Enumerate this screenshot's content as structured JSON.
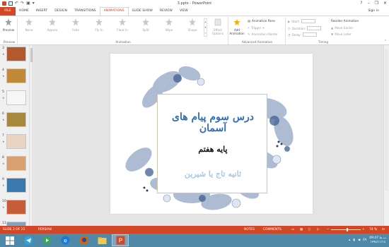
{
  "window": {
    "title": "3.pptx - PowerPoint",
    "controls": [
      "?",
      "–",
      "❐",
      "✕"
    ]
  },
  "tabs": [
    {
      "label": "FILE"
    },
    {
      "label": "HOME"
    },
    {
      "label": "INSERT"
    },
    {
      "label": "DESIGN"
    },
    {
      "label": "TRANSITIONS"
    },
    {
      "label": "ANIMATIONS"
    },
    {
      "label": "SLIDE SHOW"
    },
    {
      "label": "REVIEW"
    },
    {
      "label": "VIEW"
    }
  ],
  "active_tab": "ANIMATIONS",
  "sign_in": "Sign in",
  "ribbon": {
    "preview": "Preview",
    "effects": [
      "None",
      "Appear",
      "Fade",
      "Fly In",
      "Float In",
      "Split",
      "Wipe",
      "Shape"
    ],
    "effect_options": "Effect Options",
    "add_animation": "Add Animation",
    "animation_pane": "Animation Pane",
    "trigger": "Trigger",
    "animation_painter": "Animation Painter",
    "start": "Start:",
    "duration": "Duration:",
    "delay": "Delay:",
    "reorder": "Reorder Animation",
    "move_earlier": "Move Earlier",
    "move_later": "Move Later",
    "groups": {
      "preview": "Preview",
      "animation": "Animation",
      "advanced": "Advanced Animation",
      "timing": "Timing"
    }
  },
  "thumbnails": [
    {
      "num": "3",
      "color": "#b25a2b"
    },
    {
      "num": "4",
      "color": "#c08a3a"
    },
    {
      "num": "5",
      "color": "#f6f6f6"
    },
    {
      "num": "6",
      "color": "#a8873f"
    },
    {
      "num": "7",
      "color": "#e8d4c0"
    },
    {
      "num": "8",
      "color": "#d9a070"
    },
    {
      "num": "9",
      "color": "#3a78b0"
    },
    {
      "num": "10",
      "color": "#c65c3a"
    },
    {
      "num": "11",
      "color": "#7aa6c8"
    }
  ],
  "slide": {
    "title": "درس سوم پیام های آسمان",
    "grade": "پایه هفتم",
    "author": "ثانیه تاج یا شیرین"
  },
  "status": {
    "slide_info": "SLIDE 2 OF 25",
    "language": "PERSIAN",
    "notes": "NOTES",
    "comments": "COMMENTS",
    "zoom": "74 %"
  },
  "taskbar": {
    "lang": "FA",
    "time": "09:47 ب.ظ",
    "date": "۱۳۹۸/۱۱/۱۸"
  }
}
